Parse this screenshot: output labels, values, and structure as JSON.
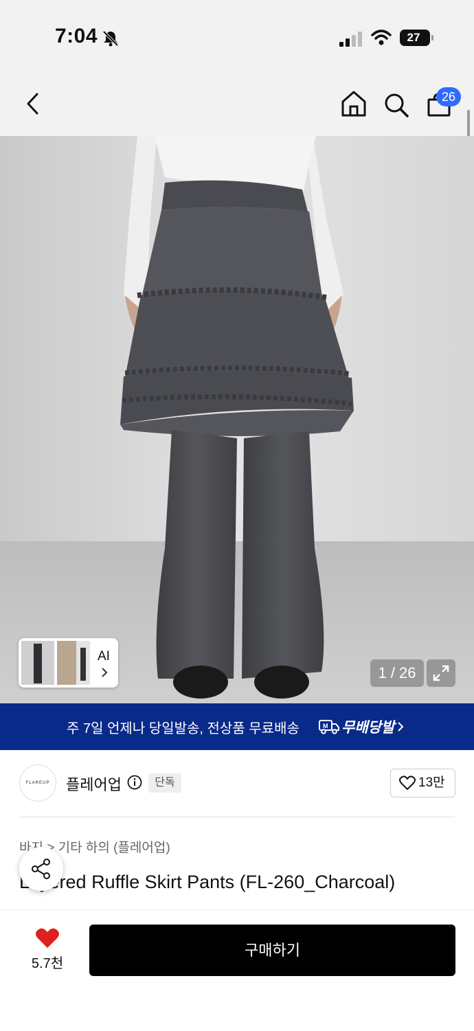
{
  "status_bar": {
    "time": "7:04",
    "battery": "27"
  },
  "nav": {
    "cart_count": "26"
  },
  "hero": {
    "ai_label": "AI",
    "page_indicator": "1 / 26"
  },
  "promo": {
    "text": "주 7일 언제나 당일발송, 전상품 무료배송",
    "brand": "무배당발"
  },
  "brand": {
    "logo_text": "FLAREUP",
    "name": "플레어업",
    "exclusive_badge": "단독",
    "likes": "13만"
  },
  "product": {
    "breadcrumb": "바지 > 기타 하의 (플레어업)",
    "title": "Layered Ruffle Skirt Pants (FL-260_Charcoal)"
  },
  "bottom": {
    "wish_count": "5.7천",
    "buy_label": "구매하기"
  },
  "colors": {
    "accent_badge": "#2f6bff",
    "promo_bg": "#0a2a8a",
    "heart": "#e0201f"
  }
}
